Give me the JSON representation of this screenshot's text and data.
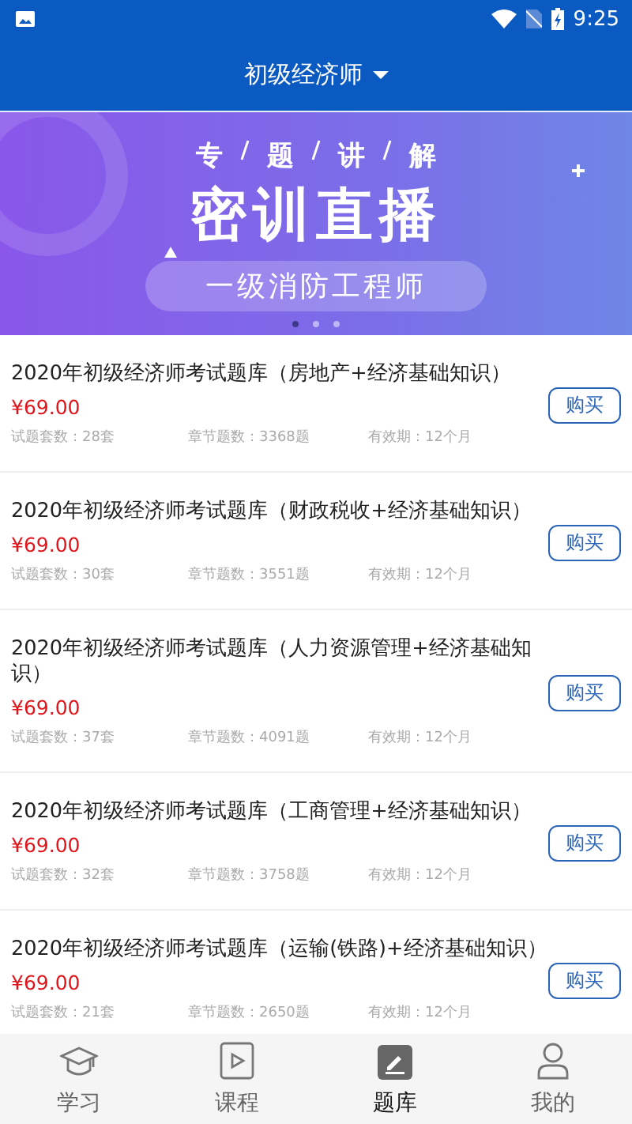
{
  "status_bar": {
    "time": "9:25"
  },
  "header": {
    "title": "初级经济师",
    "dropdown": true
  },
  "banner": {
    "topics": [
      "专",
      "题",
      "讲",
      "解"
    ],
    "headline": "密训直播",
    "subtitle": "一级消防工程师",
    "dots": [
      {
        "selected": true
      },
      {
        "selected": false
      },
      {
        "selected": false
      }
    ]
  },
  "products": [
    {
      "title": "2020年初级经济师考试题库（房地产+经济基础知识）",
      "price": "¥69.00",
      "stats": [
        "试题套数：28套",
        "章节题数：3368题",
        "有效期：12个月"
      ],
      "button": "购买"
    },
    {
      "title": "2020年初级经济师考试题库（财政税收+经济基础知识）",
      "price": "¥69.00",
      "stats": [
        "试题套数：30套",
        "章节题数：3551题",
        "有效期：12个月"
      ],
      "button": "购买"
    },
    {
      "title": "2020年初级经济师考试题库（人力资源管理+经济基础知识）",
      "price": "¥69.00",
      "stats": [
        "试题套数：37套",
        "章节题数：4091题",
        "有效期：12个月"
      ],
      "button": "购买"
    },
    {
      "title": "2020年初级经济师考试题库（工商管理+经济基础知识）",
      "price": "¥69.00",
      "stats": [
        "试题套数：32套",
        "章节题数：3758题",
        "有效期：12个月"
      ],
      "button": "购买"
    },
    {
      "title": "2020年初级经济师考试题库（运输(铁路)+经济基础知识）",
      "price": "¥69.00",
      "stats": [
        "试题套数：21套",
        "章节题数：2650题",
        "有效期：12个月"
      ],
      "button": "购买"
    }
  ],
  "nav": [
    {
      "kind": "study",
      "label": "学习",
      "selected": false
    },
    {
      "kind": "course",
      "label": "课程",
      "selected": false
    },
    {
      "kind": "bank",
      "label": "题库",
      "selected": true
    },
    {
      "kind": "me",
      "label": "我的",
      "selected": false
    }
  ]
}
